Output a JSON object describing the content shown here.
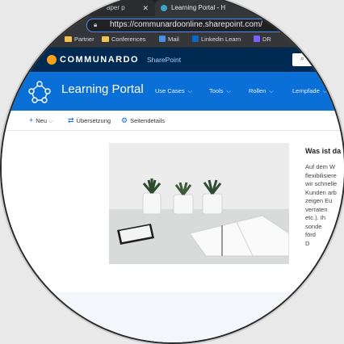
{
  "browser": {
    "tabs": [
      {
        "label": "aper p"
      },
      {
        "label": "Learning Portal - H"
      }
    ],
    "tab_close_glyph": "✕",
    "address_url": "https://communardoonline.sharepoint.com/",
    "bookmarks": [
      {
        "label": "Partner",
        "icon": "folder-icon"
      },
      {
        "label": "Conferences",
        "icon": "folder-icon"
      },
      {
        "label": "Mail",
        "icon": "mail-icon"
      },
      {
        "label": "Linkedin Learn",
        "icon": "linkedin-icon"
      },
      {
        "label": "DR",
        "icon": "bookmark-icon"
      }
    ]
  },
  "suite": {
    "brand": "COMMUNARDO",
    "product": "SharePoint"
  },
  "hub": {
    "site_title": "Learning Portal",
    "nav": [
      {
        "label": "Use Cases"
      },
      {
        "label": "Tools"
      },
      {
        "label": "Rollen"
      },
      {
        "label": "Lernpfade"
      }
    ]
  },
  "commands": {
    "new": "Neu",
    "translation": "Übersetzung",
    "page_details": "Seitendetails"
  },
  "article": {
    "heading": "Was ist da",
    "lines": [
      "Auf dem W",
      "flexibilisiere",
      "wir schnelle",
      "Kunden arb",
      "zeigen Eu",
      "verraten",
      "etc.). Ih",
      "sonde",
      "förd",
      "D"
    ]
  },
  "colors": {
    "suitebar": "#002a52",
    "hub": "#0a6fd6",
    "brand_accent": "#f7a21b"
  }
}
